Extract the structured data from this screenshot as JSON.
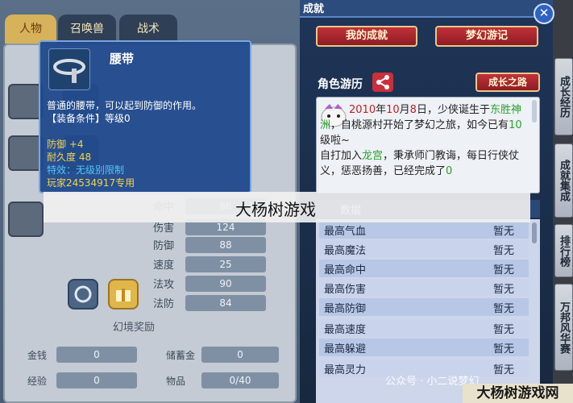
{
  "left": {
    "tabs": [
      "人物",
      "召唤兽",
      "战术"
    ],
    "stats": [
      {
        "label": "命中",
        "value": "86"
      },
      {
        "label": "伤害",
        "value": "124"
      },
      {
        "label": "防御",
        "value": "88"
      },
      {
        "label": "速度",
        "value": "25"
      },
      {
        "label": "法攻",
        "value": "90"
      },
      {
        "label": "法防",
        "value": "84"
      }
    ],
    "fantasy_reward": "幻境奖励",
    "money": [
      {
        "label": "金钱",
        "value": "0"
      },
      {
        "label": "储蓄金",
        "value": "0"
      },
      {
        "label": "经验",
        "value": "0"
      },
      {
        "label": "物品",
        "value": "0/40"
      }
    ]
  },
  "tooltip": {
    "title": "腰带",
    "description": "普通的腰带，可以起到防御的作用。",
    "requirement": "【装备条件】等级0",
    "defense": "防御 +4",
    "durability": "耐久度 48",
    "special": "特效：无级别限制",
    "owner": "玩家24534917专用"
  },
  "right": {
    "header_title": "成就",
    "btn_my_achievement": "我的成就",
    "btn_fantasy_journey": "梦幻游记",
    "roam_title": "角色游历",
    "btn_growth_path": "成长之路",
    "story": {
      "s1": "2010",
      "s2": "年",
      "s3": "10",
      "s4": "月",
      "s5": "8",
      "s6": "日，少侠诞生于",
      "s7": "东胜神洲",
      "s8": "，",
      "s9": "自桃源村",
      "s10": "开始了梦幻之旅，如今已有",
      "s11": "10",
      "s12": "级啦~",
      "s13": "自打加入",
      "s14": "龙宫",
      "s15": "，秉承师门教诲，每日行侠仗义，惩恶扬善，已经完成了",
      "s16": "0"
    },
    "data_header": "数据",
    "data_rows": [
      {
        "label": "最高气血",
        "value": "暂无"
      },
      {
        "label": "最高魔法",
        "value": "暂无"
      },
      {
        "label": "最高命中",
        "value": "暂无"
      },
      {
        "label": "最高伤害",
        "value": "暂无"
      },
      {
        "label": "最高防御",
        "value": "暂无"
      },
      {
        "label": "最高速度",
        "value": "暂无"
      },
      {
        "label": "最高躲避",
        "value": "暂无"
      },
      {
        "label": "最高灵力",
        "value": "暂无"
      }
    ]
  },
  "side_tabs": [
    "成长经历",
    "成就集成",
    "排行榜",
    "万邦风华赛"
  ],
  "close_symbol": "✕",
  "watermark": "大杨树游戏",
  "wechat_mark": "公众号 · 小二说梦幻",
  "corner_logo": "大杨树游戏网"
}
